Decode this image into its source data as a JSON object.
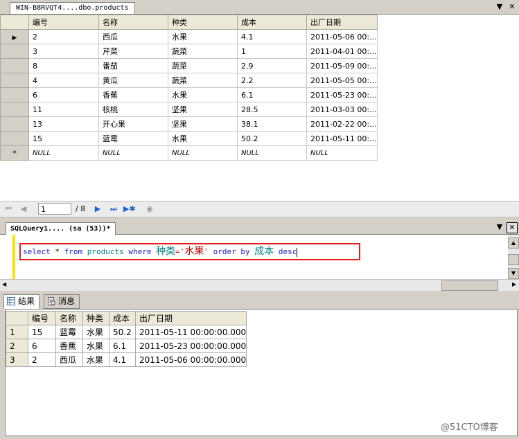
{
  "doc_tab": {
    "title": "WIN-B8RVQT4....dbo.products"
  },
  "products_grid": {
    "columns": [
      "编号",
      "名称",
      "种类",
      "成本",
      "出厂日期"
    ],
    "rows": [
      [
        "2",
        "西瓜",
        "水果",
        "4.1",
        "2011-05-06 00:..."
      ],
      [
        "3",
        "芹菜",
        "蔬菜",
        "1",
        "2011-04-01 00:..."
      ],
      [
        "8",
        "番茄",
        "蔬菜",
        "2.9",
        "2011-05-09 00:..."
      ],
      [
        "4",
        "黄瓜",
        "蔬菜",
        "2.2",
        "2011-05-05 00:..."
      ],
      [
        "6",
        "香蕉",
        "水果",
        "6.1",
        "2011-05-23 00:..."
      ],
      [
        "11",
        "核桃",
        "坚果",
        "28.5",
        "2011-03-03 00:..."
      ],
      [
        "13",
        "开心果",
        "坚果",
        "38.1",
        "2011-02-22 00:..."
      ],
      [
        "15",
        "蓝霉",
        "水果",
        "50.2",
        "2011-05-11 00:..."
      ]
    ],
    "new_row_marker": "*",
    "null_text": "NULL",
    "current_row_marker": "▶"
  },
  "navigation": {
    "current_page": "1",
    "total_pages": "/ 8"
  },
  "query_tab": {
    "title": "SQLQuery1....  (sa (53))*"
  },
  "sql": {
    "kw_select": "select",
    "star": " * ",
    "kw_from": "from",
    "table": " products ",
    "kw_where": "where",
    "col_kind": "种类",
    "eq": "='",
    "val_fruit": "水果",
    "close_quote": "' ",
    "kw_order_by": "order by",
    "col_cost": "成本",
    "kw_desc": "desc"
  },
  "result_tabs": [
    {
      "label": "结果",
      "icon": "grid-icon"
    },
    {
      "label": "消息",
      "icon": "message-icon"
    }
  ],
  "results_grid": {
    "columns": [
      "编号",
      "名称",
      "种类",
      "成本",
      "出厂日期"
    ],
    "rows": [
      [
        "1",
        "15",
        "蓝霉",
        "水果",
        "50.2",
        "2011-05-11 00:00:00.000"
      ],
      [
        "2",
        "6",
        "香蕉",
        "水果",
        "6.1",
        "2011-05-23 00:00:00.000"
      ],
      [
        "3",
        "2",
        "西瓜",
        "水果",
        "4.1",
        "2011-05-06 00:00:00.000"
      ]
    ]
  },
  "watermark": "@51CTO博客",
  "colors": {
    "highlight_box": "#e32020",
    "keyword": "#1717c8",
    "identifier": "#008080",
    "string": "#c00000"
  }
}
